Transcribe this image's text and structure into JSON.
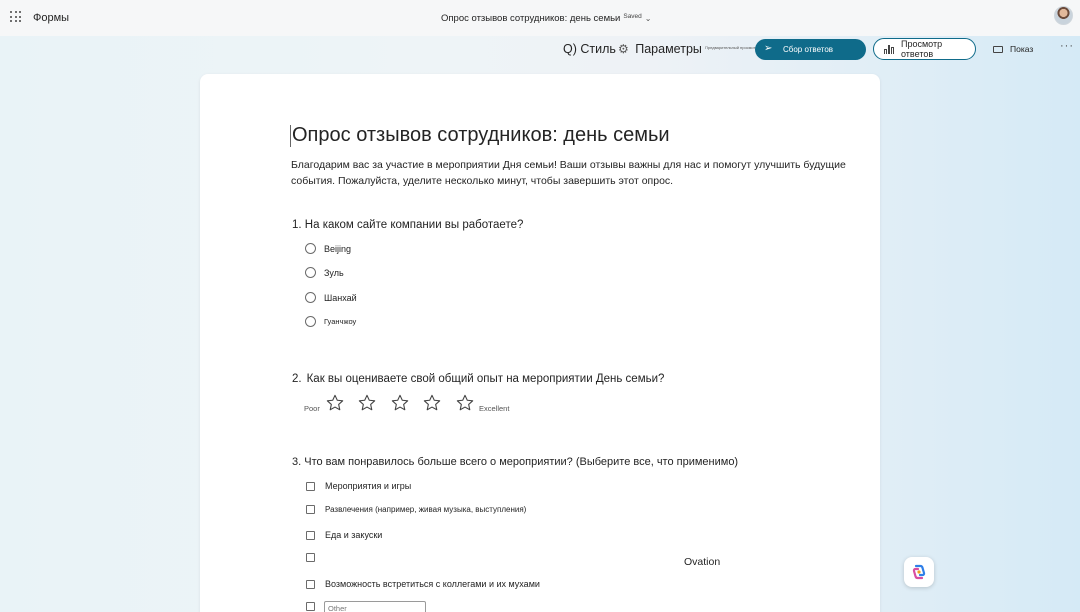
{
  "app": {
    "name": "Формы"
  },
  "header": {
    "doc_title": "Опрос отзывов сотрудников: день семьи",
    "saved": "Saved"
  },
  "toolbar": {
    "style_label": "Q) Стиль",
    "settings_label": "Параметры",
    "preview_tiny": "Предварительный просмотр",
    "collect_label": "Сбор ответов",
    "view_label": "Просмотр ответов",
    "show_label": "Показ",
    "accent": "#0f6b8a"
  },
  "form": {
    "title": "Опрос отзывов сотрудников: день семьи",
    "description": "Благодарим вас за участие в мероприятии Дня семьи! Ваши отзывы важны для нас и помогут улучшить будущие события. Пожалуйста, уделите несколько минут, чтобы завершить этот опрос.",
    "questions": [
      {
        "number": "1.",
        "text": "На каком сайте компании вы работаете?",
        "type": "radio",
        "options": [
          "Beijing",
          "Зуль",
          "Шанхай",
          "Гуанчжоу"
        ]
      },
      {
        "number": "2.",
        "text": "Как вы оцениваете свой общий опыт на мероприятии День семьи?",
        "type": "rating",
        "min_label": "Poor",
        "max_label": "Excellent",
        "stars": 5
      },
      {
        "number": "3.",
        "text": "Что вам понравилось больше всего о мероприятии? (Выберите все, что применимо)",
        "type": "checkbox",
        "options": [
          "Мероприятия и игры",
          "Развлечения (например, живая музыка, выступления)",
          "Еда и закуски",
          "",
          "Возможность встретиться с коллегами и их мухами"
        ],
        "other_placeholder": "Other"
      }
    ]
  },
  "floating": {
    "ovation": "Ovation"
  }
}
